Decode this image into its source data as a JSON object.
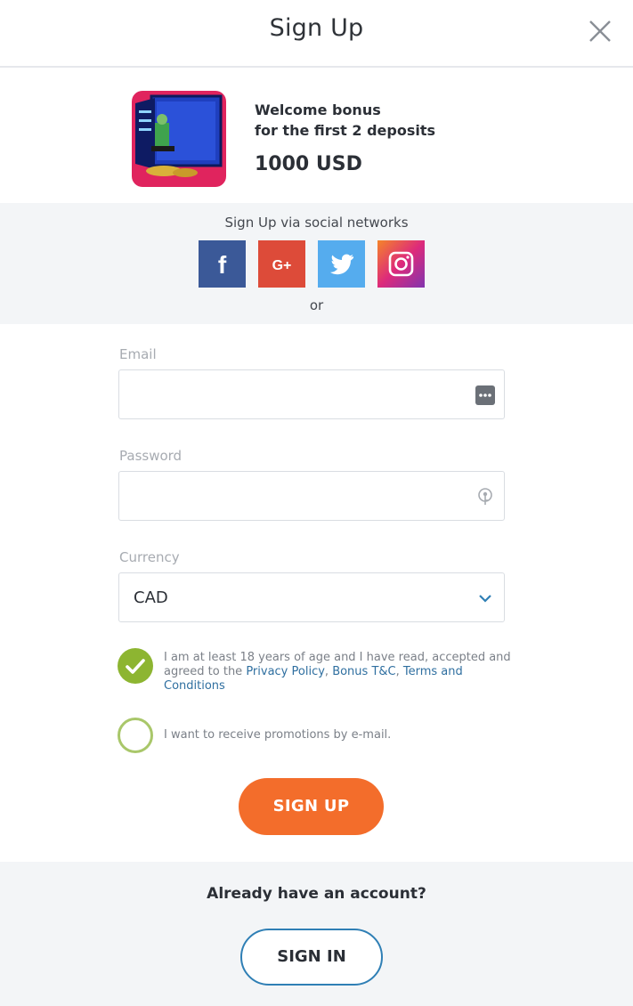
{
  "header": {
    "title": "Sign Up"
  },
  "bonus": {
    "line1": "Welcome bonus",
    "line2": "for the first 2 deposits",
    "amount": "1000 USD"
  },
  "social": {
    "label": "Sign Up via social networks",
    "networks": [
      {
        "name": "facebook",
        "glyph": "f",
        "color": "#3b5998"
      },
      {
        "name": "google-plus",
        "glyph": "G+",
        "color": "#dd4b39"
      },
      {
        "name": "twitter",
        "glyph": "twitter-bird",
        "color": "#55acee"
      },
      {
        "name": "instagram",
        "glyph": "camera",
        "color": "#c13584"
      }
    ],
    "or": "or"
  },
  "form": {
    "email_label": "Email",
    "email_value": "",
    "password_label": "Password",
    "password_value": "",
    "currency_label": "Currency",
    "currency_value": "CAD",
    "terms_text": "I am at least 18 years of age and I have read, accepted and agreed to the ",
    "terms_link_privacy": "Privacy Policy",
    "terms_sep1": ", ",
    "terms_link_bonus": "Bonus T&C",
    "terms_sep2": ", ",
    "terms_link_terms": "Terms and Conditions",
    "terms_checked": true,
    "promo_text": "I want to receive promotions by e-mail.",
    "promo_checked": false,
    "signup_label": "SIGN UP"
  },
  "footer": {
    "question": "Already have an account?",
    "signin_label": "SIGN IN"
  },
  "colors": {
    "accent": "#f36d2b",
    "check": "#8db531",
    "link": "#2f6fa0",
    "signin_border": "#2f7fb5"
  }
}
